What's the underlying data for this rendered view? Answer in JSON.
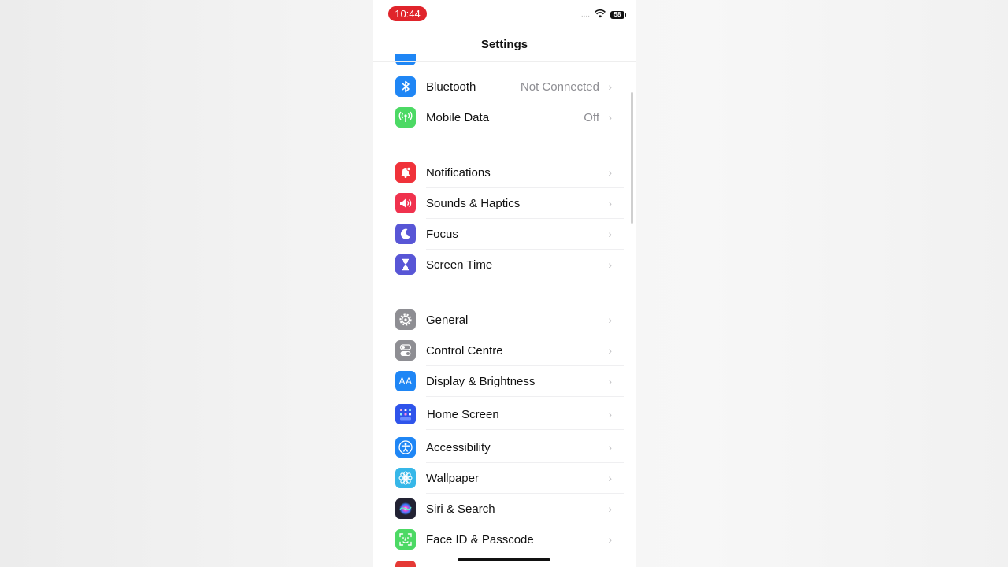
{
  "status_bar": {
    "time": "10:44",
    "signal": "....",
    "battery": "58"
  },
  "nav": {
    "title": "Settings"
  },
  "colors": {
    "bluetooth": "#1f86f5",
    "mobile_data": "#4cd964",
    "notifications": "#f0323a",
    "sounds": "#f0324e",
    "focus": "#5856d6",
    "screen_time": "#5856d6",
    "general": "#8e8e93",
    "control_centre": "#8e8e93",
    "display": "#1f86f5",
    "home_screen": "#2f54eb",
    "accessibility": "#1f86f5",
    "wallpaper": "#36b7e8",
    "siri": "#222233",
    "face_id": "#4cd964"
  },
  "rows": {
    "bluetooth": {
      "label": "Bluetooth",
      "value": "Not Connected",
      "icon": "bluetooth-icon"
    },
    "mobile_data": {
      "label": "Mobile Data",
      "value": "Off",
      "icon": "antenna-icon"
    },
    "notifications": {
      "label": "Notifications",
      "icon": "bell-icon"
    },
    "sounds": {
      "label": "Sounds & Haptics",
      "icon": "speaker-icon"
    },
    "focus": {
      "label": "Focus",
      "icon": "moon-icon"
    },
    "screen_time": {
      "label": "Screen Time",
      "icon": "hourglass-icon"
    },
    "general": {
      "label": "General",
      "icon": "gear-icon"
    },
    "control_centre": {
      "label": "Control Centre",
      "icon": "toggles-icon"
    },
    "display": {
      "label": "Display & Brightness",
      "icon": "text-size-icon",
      "icon_text": "AA"
    },
    "home_screen": {
      "label": "Home Screen",
      "icon": "app-grid-icon"
    },
    "accessibility": {
      "label": "Accessibility",
      "icon": "accessibility-icon"
    },
    "wallpaper": {
      "label": "Wallpaper",
      "icon": "flower-icon"
    },
    "siri": {
      "label": "Siri & Search",
      "icon": "siri-icon"
    },
    "face_id": {
      "label": "Face ID & Passcode",
      "icon": "face-id-icon"
    }
  }
}
